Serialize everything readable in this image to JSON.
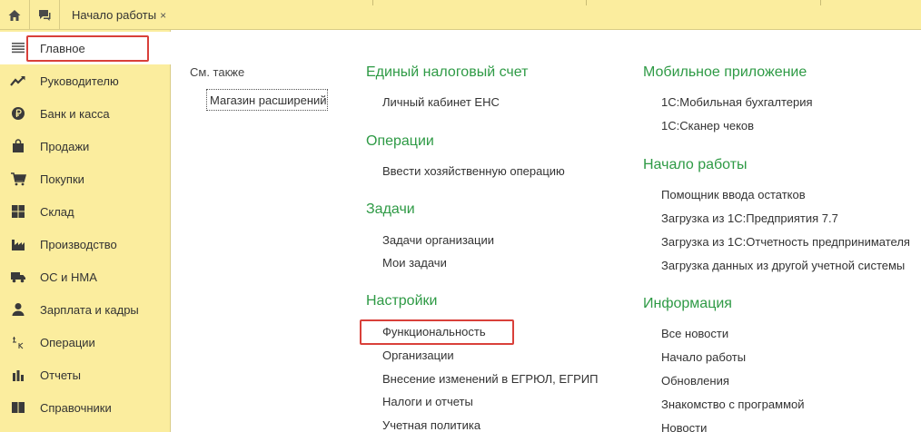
{
  "topbar": {
    "home_icon": "home-icon",
    "messages_icon": "chat-icon",
    "tab": {
      "label": "Начало работы",
      "close": "×"
    }
  },
  "sidebar": {
    "items": [
      {
        "label": "Главное",
        "icon": "menu-icon",
        "active": true
      },
      {
        "label": "Руководителю",
        "icon": "trend-up-icon"
      },
      {
        "label": "Банк и касса",
        "icon": "ruble-coin-icon"
      },
      {
        "label": "Продажи",
        "icon": "shopping-bag-icon"
      },
      {
        "label": "Покупки",
        "icon": "cart-icon"
      },
      {
        "label": "Склад",
        "icon": "warehouse-grid-icon"
      },
      {
        "label": "Производство",
        "icon": "factory-icon"
      },
      {
        "label": "ОС и НМА",
        "icon": "truck-icon"
      },
      {
        "label": "Зарплата и кадры",
        "icon": "person-icon"
      },
      {
        "label": "Операции",
        "icon": "debit-credit-icon"
      },
      {
        "label": "Отчеты",
        "icon": "bar-chart-icon"
      },
      {
        "label": "Справочники",
        "icon": "book-icon"
      }
    ]
  },
  "main": {
    "see_also": {
      "label": "См. также",
      "link": "Магазин расширений"
    },
    "col1": [
      {
        "title": "Единый налоговый счет",
        "links": [
          "Личный кабинет ЕНС"
        ]
      },
      {
        "title": "Операции",
        "links": [
          "Ввести хозяйственную операцию"
        ]
      },
      {
        "title": "Задачи",
        "links": [
          "Задачи организации",
          "Мои задачи"
        ]
      },
      {
        "title": "Настройки",
        "links": [
          "Функциональность",
          "Организации",
          "Внесение изменений в ЕГРЮЛ, ЕГРИП",
          "Налоги и отчеты",
          "Учетная политика"
        ]
      }
    ],
    "col2": [
      {
        "title": "Мобильное приложение",
        "links": [
          "1С:Мобильная бухгалтерия",
          "1С:Сканер чеков"
        ]
      },
      {
        "title": "Начало работы",
        "links": [
          "Помощник ввода остатков",
          "Загрузка из 1С:Предприятия 7.7",
          "Загрузка из 1С:Отчетность предпринимателя",
          "Загрузка данных из другой учетной системы"
        ]
      },
      {
        "title": "Информация",
        "links": [
          "Все новости",
          "Начало работы",
          "Обновления",
          "Знакомство с программой",
          "Новости"
        ]
      }
    ]
  },
  "colors": {
    "sidebar_bg": "#fbed9e",
    "section_title": "#2e9a45",
    "highlight": "#d9403a"
  }
}
